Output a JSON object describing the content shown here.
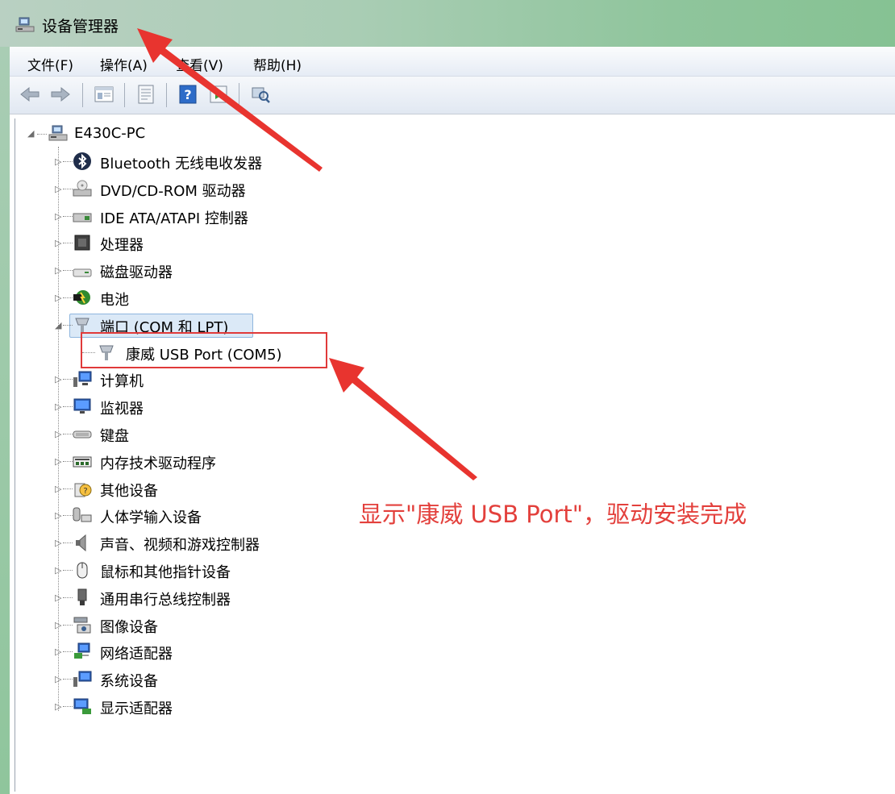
{
  "window": {
    "title": "设备管理器",
    "title_icon": "device-manager-icon"
  },
  "menu": {
    "file": "文件(F)",
    "action": "操作(A)",
    "view": "查看(V)",
    "help": "帮助(H)"
  },
  "toolbar": {
    "buttons": [
      "back-arrow-icon",
      "forward-arrow-icon",
      "show-hide-console-tree-icon",
      "properties-icon",
      "help-icon",
      "run-icon",
      "scan-hardware-icon"
    ]
  },
  "tree": {
    "root": {
      "label": "E430C-PC",
      "icon": "computer-icon",
      "expanded": true
    },
    "items": [
      {
        "label": "Bluetooth 无线电收发器",
        "icon": "bluetooth-icon"
      },
      {
        "label": "DVD/CD-ROM 驱动器",
        "icon": "dvd-drive-icon"
      },
      {
        "label": "IDE ATA/ATAPI 控制器",
        "icon": "ide-controller-icon"
      },
      {
        "label": "处理器",
        "icon": "processor-icon"
      },
      {
        "label": "磁盘驱动器",
        "icon": "disk-drive-icon"
      },
      {
        "label": "电池",
        "icon": "battery-icon"
      },
      {
        "label": "端口 (COM 和 LPT)",
        "icon": "port-icon",
        "expanded": true,
        "selected": true,
        "children": [
          {
            "label": "康威 USB Port (COM5)",
            "icon": "port-icon"
          }
        ]
      },
      {
        "label": "计算机",
        "icon": "computer-icon"
      },
      {
        "label": "监视器",
        "icon": "monitor-icon"
      },
      {
        "label": "键盘",
        "icon": "keyboard-icon"
      },
      {
        "label": "内存技术驱动程序",
        "icon": "memory-icon"
      },
      {
        "label": "其他设备",
        "icon": "unknown-device-icon"
      },
      {
        "label": "人体学输入设备",
        "icon": "hid-icon"
      },
      {
        "label": "声音、视频和游戏控制器",
        "icon": "speaker-icon"
      },
      {
        "label": "鼠标和其他指针设备",
        "icon": "mouse-icon"
      },
      {
        "label": "通用串行总线控制器",
        "icon": "usb-icon"
      },
      {
        "label": "图像设备",
        "icon": "camera-icon"
      },
      {
        "label": "网络适配器",
        "icon": "network-adapter-icon"
      },
      {
        "label": "系统设备",
        "icon": "system-device-icon"
      },
      {
        "label": "显示适配器",
        "icon": "display-adapter-icon"
      }
    ]
  },
  "annotation": {
    "text": "显示\"康威 USB Port\"，驱动安装完成",
    "color": "#e3403c"
  },
  "colors": {
    "arrow": "#e8342f",
    "highlight_box": "#e03a3a",
    "selection": "#dbe9f7"
  }
}
